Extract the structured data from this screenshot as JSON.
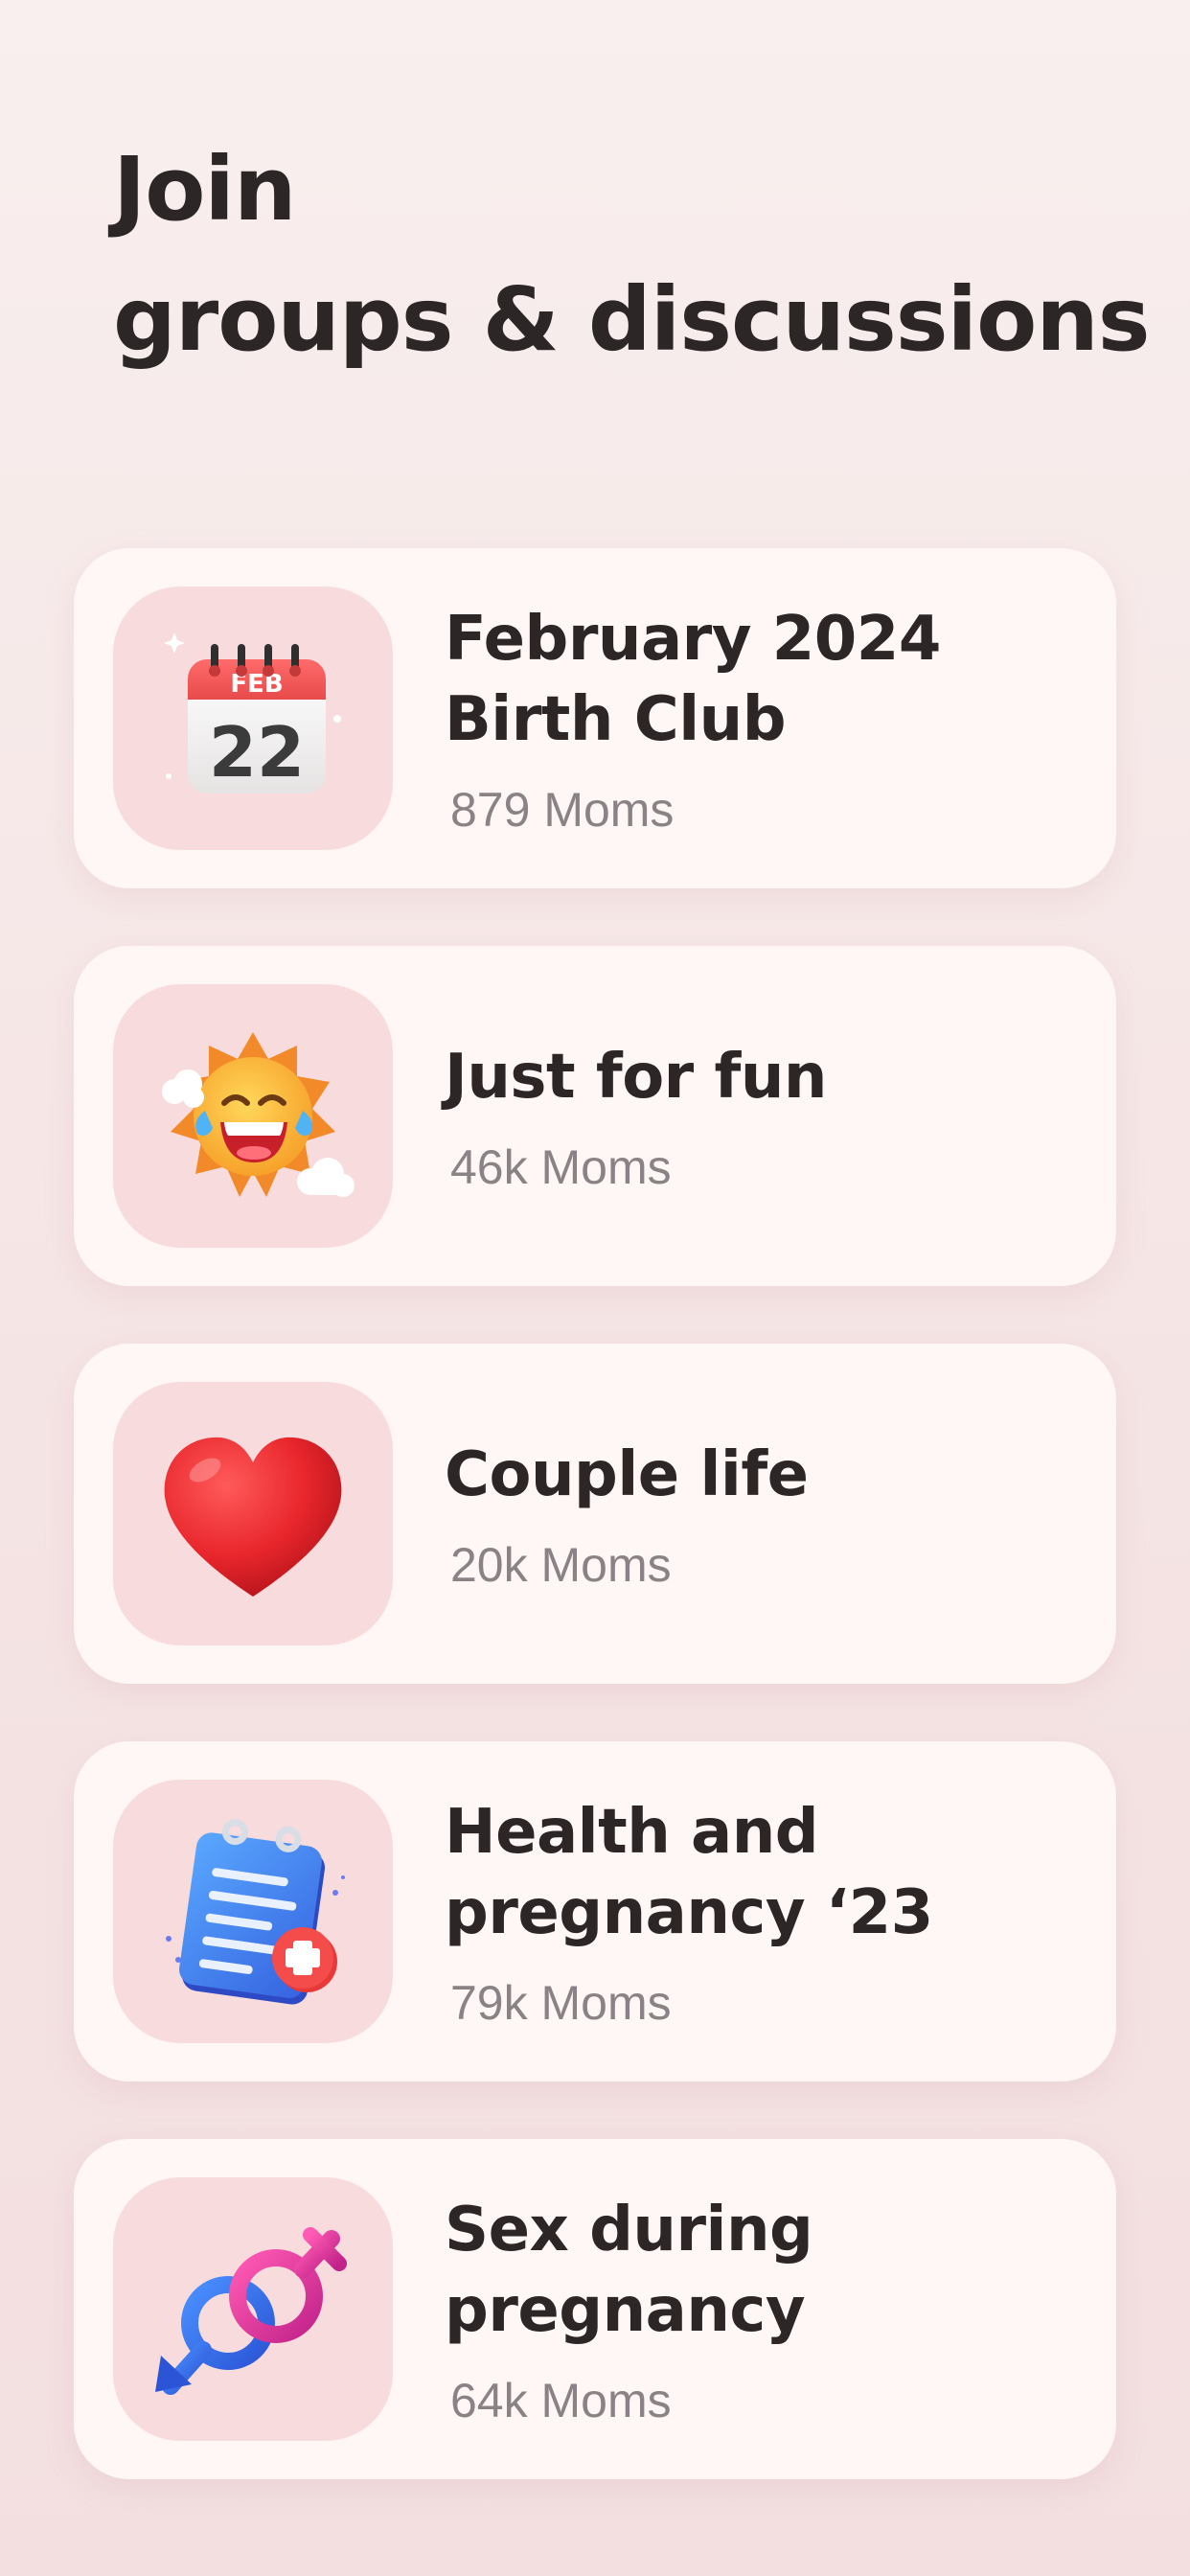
{
  "header": {
    "title_line1": "Join",
    "title_line2": "groups & discussions"
  },
  "groups": [
    {
      "title": "February 2024\nBirth Club",
      "count": "879 Moms",
      "icon": "calendar-icon",
      "icon_text_month": "FEB",
      "icon_text_day": "22"
    },
    {
      "title": "Just for fun",
      "count": "46k Moms",
      "icon": "laughing-sun-icon"
    },
    {
      "title": "Couple life",
      "count": "20k Moms",
      "icon": "heart-icon"
    },
    {
      "title": "Health and\npregnancy ‘23",
      "count": "79k Moms",
      "icon": "medical-notepad-icon"
    },
    {
      "title": "Sex during\npregnancy",
      "count": "64k Moms",
      "icon": "gender-symbols-icon"
    }
  ],
  "colors": {
    "background": "#f8efee",
    "card": "#fff6f6",
    "icon_tile": "#f8dcdd",
    "title_text": "#2d2627",
    "count_text": "#8a8385"
  }
}
